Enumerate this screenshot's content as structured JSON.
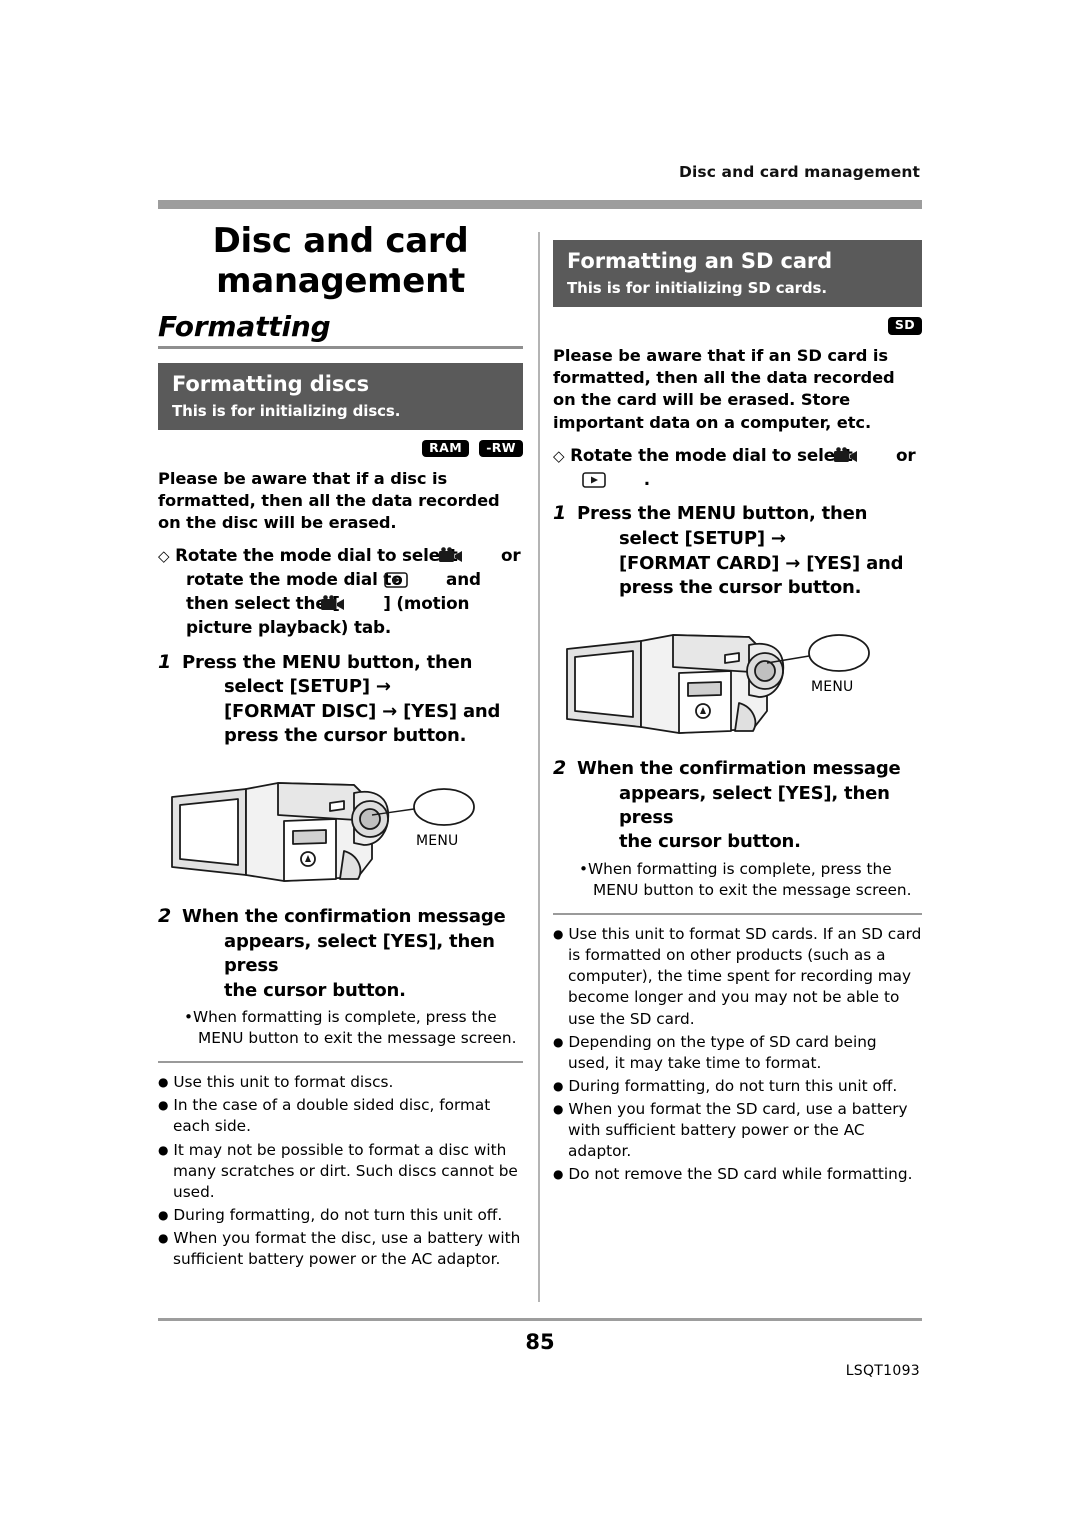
{
  "header": {
    "running_head": "Disc and card management"
  },
  "left_column": {
    "chapter_title_line1": "Disc and card",
    "chapter_title_line2": "management",
    "section_title": "Formatting",
    "head_box": {
      "title": "Formatting discs",
      "subtitle": "This is for initializing discs."
    },
    "badges": [
      "RAM",
      "-RW"
    ],
    "warning": "Please be aware that if a disc is formatted, then all the data recorded on the disc will be erased.",
    "diamond_item": {
      "diamond": "◇",
      "text_1": "Rotate the mode dial to select",
      "icon_1": "movie-camera-icon",
      "text_2": "or rotate the mode dial to",
      "icon_2": "playback-icon",
      "text_3": "and then select the [",
      "icon_3": "movie-camera-icon",
      "text_4": "] (motion picture playback) tab."
    },
    "step1": {
      "number": "1",
      "line1": "Press the MENU button, then",
      "line2": "select [SETUP] →",
      "line3": "[FORMAT DISC] → [YES] and",
      "line4": "press the cursor button."
    },
    "figure": {
      "menu_label": "MENU"
    },
    "step2": {
      "number": "2",
      "line1": "When the confirmation message",
      "line2": "appears, select [YES], then press",
      "line3": "the cursor button.",
      "note": "•When formatting is complete, press the MENU button to exit the message screen."
    },
    "bullets": [
      "Use this unit to format discs.",
      "In the case of a double sided disc, format each side.",
      "It may not be possible to format a disc with many scratches or dirt. Such discs cannot be used.",
      "During formatting, do not turn this unit off.",
      "When you format the disc, use a battery with sufficient battery power or the AC adaptor."
    ]
  },
  "right_column": {
    "head_box": {
      "title": "Formatting an SD card",
      "subtitle": "This is for initializing SD cards."
    },
    "badges": [
      "SD"
    ],
    "warning": "Please be aware that if an SD card is formatted, then all the data recorded on the card will be erased. Store important data on a computer, etc.",
    "diamond_item": {
      "diamond": "◇",
      "text_1": "Rotate the mode dial to select",
      "icon_1": "movie-camera-icon",
      "text_2": "or",
      "icon_2": "playback-icon",
      "text_3": "."
    },
    "step1": {
      "number": "1",
      "line1": "Press the MENU button, then",
      "line2": "select [SETUP] →",
      "line3": "[FORMAT CARD] → [YES] and",
      "line4": "press the cursor button."
    },
    "figure": {
      "menu_label": "MENU"
    },
    "step2": {
      "number": "2",
      "line1": "When the confirmation message",
      "line2": "appears, select [YES], then press",
      "line3": "the cursor button.",
      "note": "•When formatting is complete, press the MENU button to exit the message screen."
    },
    "bullets": [
      "Use this unit to format SD cards. If an SD card is formatted on other products (such as a computer), the time spent for recording may become longer and you may not be able to use the SD card.",
      "Depending on the type of SD card being used, it may take time to format.",
      "During formatting, do not turn this unit off.",
      "When you format the SD card, use a battery with sufficient battery power or the AC adaptor.",
      "Do not remove the SD card while formatting."
    ]
  },
  "footer": {
    "page_number": "85",
    "doc_code": "LSQT1093"
  }
}
